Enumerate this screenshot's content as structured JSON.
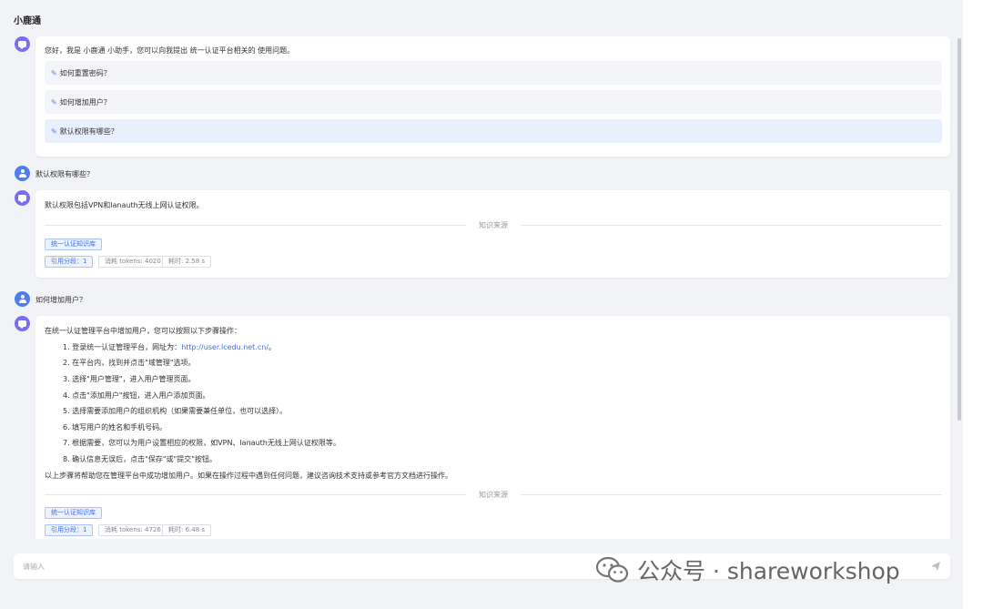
{
  "app": {
    "title": "小鹿通"
  },
  "colors": {
    "accent": "#4e7df0",
    "bot_avatar": "#7b6cf0",
    "user_avatar": "#4e7df0",
    "background": "#f2f3f7"
  },
  "messages": {
    "greeting": {
      "text": "您好，我是 小鹿通 小助手，您可以向我提出 统一认证平台相关的 使用问题。",
      "suggestions": [
        "如何重置密码？",
        "如何增加用户？",
        "默认权限有哪些？"
      ]
    },
    "q1": {
      "text": "默认权限有哪些？"
    },
    "a1": {
      "text": "默认权限包括VPN和lanauth无线上网认证权限。",
      "source_label": "知识来源",
      "kb_tag": "统一认证知识库",
      "cite_tag": "引用分段：1",
      "tokens_tag": "消耗 tokens: 4020",
      "time_tag": "耗时: 2.58 s"
    },
    "q2": {
      "text": "如何增加用户？"
    },
    "a2": {
      "intro": "在统一认证管理平台中增加用户，您可以按照以下步骤操作：",
      "step1_prefix": "1. 登录统一认证管理平台，网址为：",
      "step1_link": "http://user.lcedu.net.cn/",
      "step1_suffix": "。",
      "steps": [
        "2. 在平台内，找到并点击\"域管理\"选项。",
        "3. 选择\"用户管理\"，进入用户管理页面。",
        "4. 点击\"添加用户\"按钮，进入用户添加页面。",
        "5. 选择需要添加用户的组织机构（如果需要兼任单位，也可以选择）。",
        "6. 填写用户的姓名和手机号码。",
        "7. 根据需要，您可以为用户设置相应的权限，如VPN、lanauth无线上网认证权限等。",
        "8. 确认信息无误后，点击\"保存\"或\"提交\"按钮。"
      ],
      "outro": "以上步骤将帮助您在管理平台中成功增加用户。如果在操作过程中遇到任何问题，建议咨询技术支持或参考官方文档进行操作。",
      "source_label": "知识来源",
      "kb_tag": "统一认证知识库",
      "cite_tag": "引用分段：1",
      "tokens_tag": "消耗 tokens: 4726",
      "time_tag": "耗时: 6.48 s"
    }
  },
  "input": {
    "placeholder": "请输入"
  },
  "watermark": {
    "text": "公众号 · shareworkshop"
  }
}
